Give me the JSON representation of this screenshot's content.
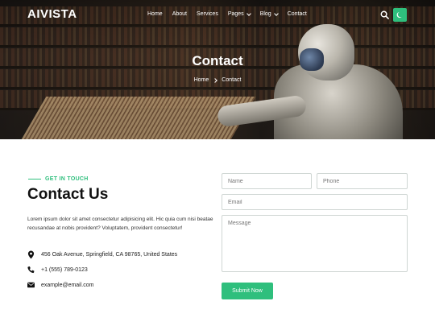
{
  "brand": {
    "logo": "AIVISTA",
    "accent": "#2fbf7d"
  },
  "nav": {
    "items": [
      {
        "label": "Home",
        "dropdown": false
      },
      {
        "label": "About",
        "dropdown": false
      },
      {
        "label": "Services",
        "dropdown": false
      },
      {
        "label": "Pages",
        "dropdown": true
      },
      {
        "label": "Blog",
        "dropdown": true
      },
      {
        "label": "Contact",
        "dropdown": false
      }
    ],
    "search_icon": "search-icon",
    "theme_icon": "moon-icon"
  },
  "hero": {
    "title": "Contact",
    "breadcrumb": {
      "home": "Home",
      "current": "Contact"
    }
  },
  "contact": {
    "eyebrow": "GET IN TOUCH",
    "title": "Contact Us",
    "description": "Lorem ipsum dolor sit amet consectetur adipisicing elit. Hic quia cum nisi beatae recusandae at nobis provident? Voluptatem, provident consectetur!",
    "address": "456 Oak Avenue, Springfield, CA 98765, United States",
    "phone": "+1 (555) 789-0123",
    "email": "example@email.com"
  },
  "form": {
    "name_placeholder": "Name",
    "phone_placeholder": "Phone",
    "email_placeholder": "Email",
    "message_placeholder": "Message",
    "submit_label": "Submit Now"
  }
}
